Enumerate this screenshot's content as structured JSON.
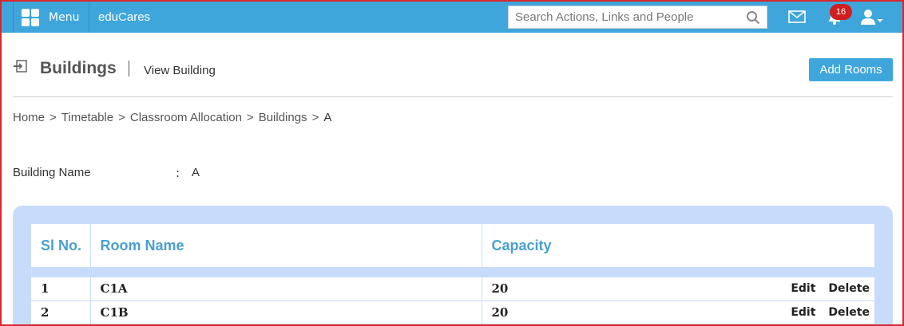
{
  "topbar": {
    "menu_label": "Menu",
    "brand": "eduCares",
    "search_placeholder": "Search Actions, Links and People",
    "notification_count": "16"
  },
  "header": {
    "title": "Buildings",
    "subtitle": "View Building",
    "add_button": "Add Rooms"
  },
  "breadcrumb": [
    "Home",
    "Timetable",
    "Classroom Allocation",
    "Buildings",
    "A"
  ],
  "building": {
    "label": "Building Name",
    "separator": ":",
    "value": "A"
  },
  "table": {
    "columns": [
      "Sl No.",
      "Room Name",
      "Capacity"
    ],
    "rows": [
      {
        "sl": "1",
        "room": "C1A",
        "capacity": "20",
        "edit": "Edit",
        "delete": "Delete"
      },
      {
        "sl": "2",
        "room": "C1B",
        "capacity": "20",
        "edit": "Edit",
        "delete": "Delete"
      }
    ]
  },
  "colors": {
    "accent": "#3fa6dc",
    "panel": "#c7dcfb",
    "badge": "#d21e1e",
    "frame": "#d9262c"
  }
}
